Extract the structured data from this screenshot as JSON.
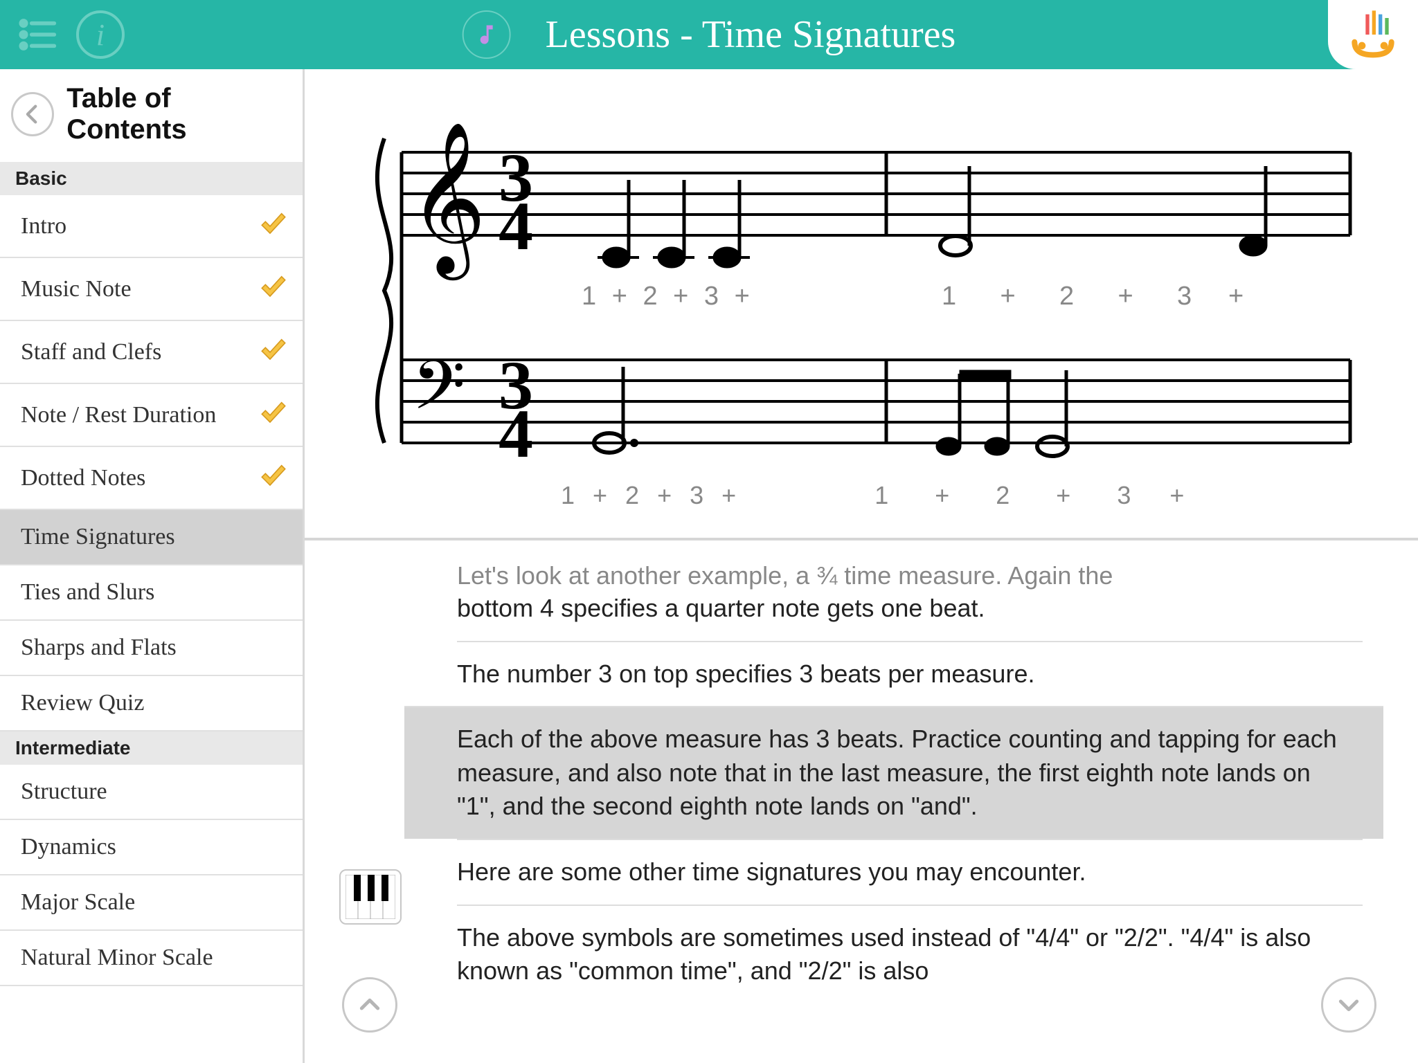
{
  "header": {
    "title": "Lessons - Time Signatures"
  },
  "sidebar": {
    "toc_title": "Table of Contents",
    "sections": [
      {
        "label": "Basic",
        "items": [
          {
            "label": "Intro",
            "done": true,
            "active": false
          },
          {
            "label": "Music Note",
            "done": true,
            "active": false
          },
          {
            "label": "Staff and Clefs",
            "done": true,
            "active": false
          },
          {
            "label": "Note / Rest Duration",
            "done": true,
            "active": false
          },
          {
            "label": "Dotted Notes",
            "done": true,
            "active": false
          },
          {
            "label": "Time Signatures",
            "done": false,
            "active": true
          },
          {
            "label": "Ties and Slurs",
            "done": false,
            "active": false
          },
          {
            "label": "Sharps and Flats",
            "done": false,
            "active": false
          },
          {
            "label": "Review Quiz",
            "done": false,
            "active": false
          }
        ]
      },
      {
        "label": "Intermediate",
        "items": [
          {
            "label": "Structure",
            "done": false,
            "active": false
          },
          {
            "label": "Dynamics",
            "done": false,
            "active": false
          },
          {
            "label": "Major Scale",
            "done": false,
            "active": false
          },
          {
            "label": "Natural Minor Scale",
            "done": false,
            "active": false
          }
        ]
      }
    ]
  },
  "staff": {
    "time_signature": "3/4",
    "treble_beats": "1  +  2  +  3  +            1       +       2       +       3      +",
    "bass_beats": "1  +  2  +  3  +            1       +       2       +       3      +"
  },
  "content": {
    "p0_cut": "Let's look at another example, a ¾ time measure. Again the",
    "p0_rest": "bottom 4 specifies a quarter note gets one beat.",
    "p1": "The number 3 on top specifies 3 beats per measure.",
    "p2": "Each of the above measure has 3 beats. Practice counting and tapping for each measure, and also note that in the last measure, the first eighth note lands on \"1\", and the second eighth note lands on \"and\".",
    "p3": "Here are some other time signatures you may encounter.",
    "p4": "The above symbols are sometimes used instead of \"4/4\" or \"2/2\". \"4/4\" is also known as \"common time\", and \"2/2\" is also"
  }
}
